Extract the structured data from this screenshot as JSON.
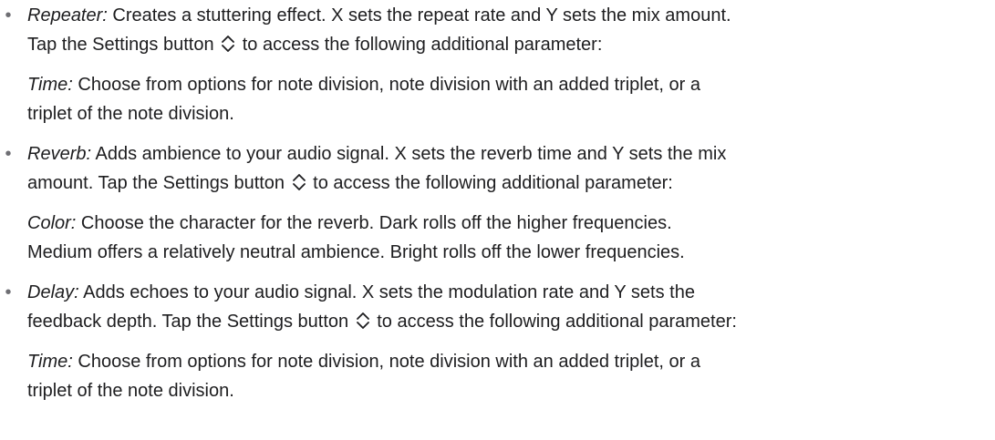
{
  "items": [
    {
      "bullet": "•",
      "term": "Repeater:",
      "text1": " Creates a stuttering effect. X sets the repeat rate and Y sets the mix amount.",
      "text2": "Tap the Settings button ",
      "icon": "chevron-up-down-icon",
      "text3": " to access the following additional parameter:",
      "sub_term": "Time:",
      "sub_text1": " Choose from options for note division, note division with an added triplet, or a",
      "sub_text2": "triplet of the note division."
    },
    {
      "bullet": "•",
      "term": "Reverb:",
      "text1": " Adds ambience to your audio signal. X sets the reverb time and Y sets the mix",
      "text2": "amount. Tap the Settings button ",
      "icon": "chevron-up-down-icon",
      "text3": " to access the following additional parameter:",
      "sub_term": "Color:",
      "sub_text1": " Choose the character for the reverb. Dark rolls off the higher frequencies.",
      "sub_text2": "Medium offers a relatively neutral ambience. Bright rolls off the lower frequencies."
    },
    {
      "bullet": "•",
      "term": "Delay:",
      "text1": " Adds echoes to your audio signal. X sets the modulation rate and Y sets the",
      "text2": "feedback depth. Tap the Settings button ",
      "icon": "chevron-up-down-icon",
      "text3": " to access the following additional parameter:",
      "sub_term": "Time:",
      "sub_text1": " Choose from options for note division, note division with an added triplet, or a",
      "sub_text2": "triplet of the note division."
    }
  ],
  "colors": {
    "text": "#1d1d1f",
    "bullet": "#6e6e73"
  }
}
